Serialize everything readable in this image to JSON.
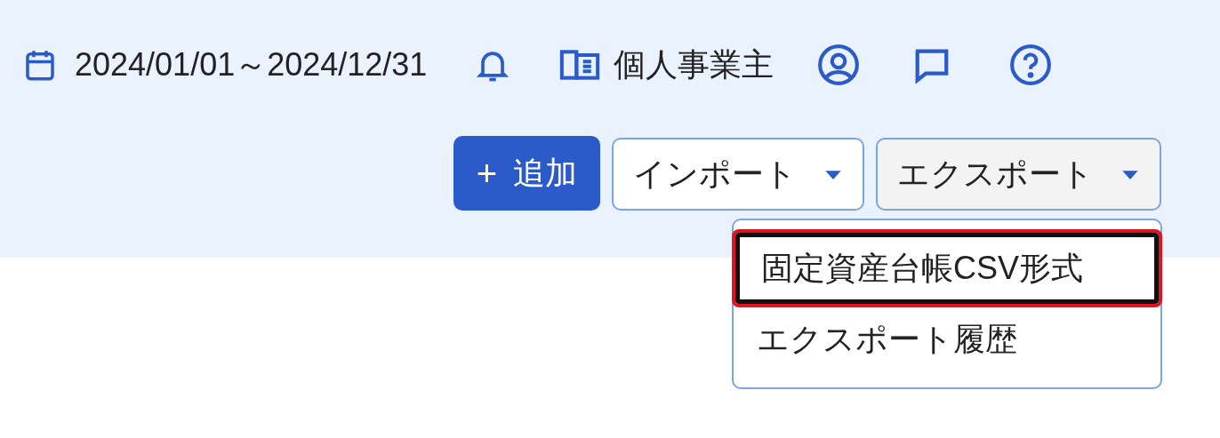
{
  "header": {
    "date_range": "2024/01/01～2024/12/31",
    "business_type": "個人事業主"
  },
  "actions": [
    {
      "label": "追加",
      "kind": "primary",
      "icon": "+"
    },
    {
      "label": "インポート",
      "kind": "dropdown",
      "expanded": false
    },
    {
      "label": "エクスポート",
      "kind": "dropdown",
      "expanded": true
    }
  ],
  "export_menu": {
    "items": [
      {
        "label": "固定資産台帳CSV形式",
        "focused": true
      },
      {
        "label": "エクスポート履歴",
        "focused": false
      }
    ]
  }
}
